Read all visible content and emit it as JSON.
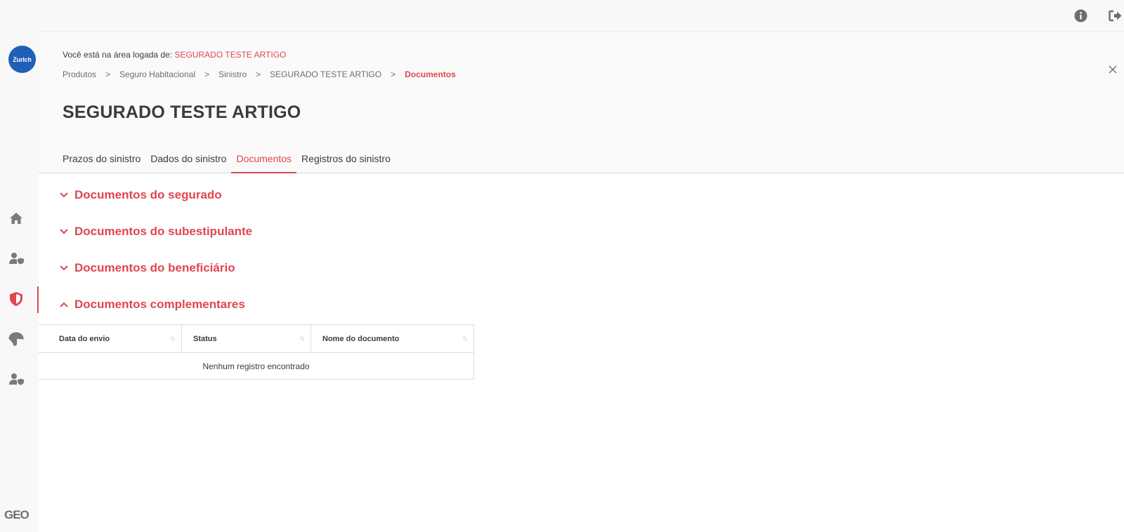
{
  "sidebar": {
    "logo_text": "Zurich",
    "nav_icons": [
      "home-icon",
      "user-shield-icon",
      "shield-icon",
      "umbrella-icon",
      "user-shield-icon"
    ],
    "active_index": 2,
    "footer_logo": "GEO"
  },
  "topbar": {
    "icons": [
      "info-icon",
      "logout-icon"
    ]
  },
  "header": {
    "logged_prefix": "Você está na área logada de: ",
    "logged_name": "SEGURADO TESTE ARTIGO",
    "breadcrumb": [
      "Produtos",
      "Seguro Habitacional",
      "Sinistro",
      "SEGURADO TESTE ARTIGO",
      "Documentos"
    ],
    "breadcrumb_separator": ">",
    "title": "SEGURADO TESTE ARTIGO"
  },
  "tabs": [
    {
      "label": "Prazos do sinistro",
      "active": false
    },
    {
      "label": "Dados do sinistro",
      "active": false
    },
    {
      "label": "Documentos",
      "active": true
    },
    {
      "label": "Registros do sinistro",
      "active": false
    }
  ],
  "sections": [
    {
      "label": "Documentos do segurado",
      "expanded": false
    },
    {
      "label": "Documentos do subestipulante",
      "expanded": false
    },
    {
      "label": "Documentos do beneficiário",
      "expanded": false
    },
    {
      "label": "Documentos complementares",
      "expanded": true
    }
  ],
  "table": {
    "columns": [
      "Data do envio",
      "Status",
      "Nome do documento"
    ],
    "sort_glyph": "↑↓",
    "empty_message": "Nenhum registro encontrado"
  },
  "colors": {
    "accent": "#e0464f",
    "brand_blue": "#1f5fb8",
    "icon_gray": "#7a7a7a"
  }
}
